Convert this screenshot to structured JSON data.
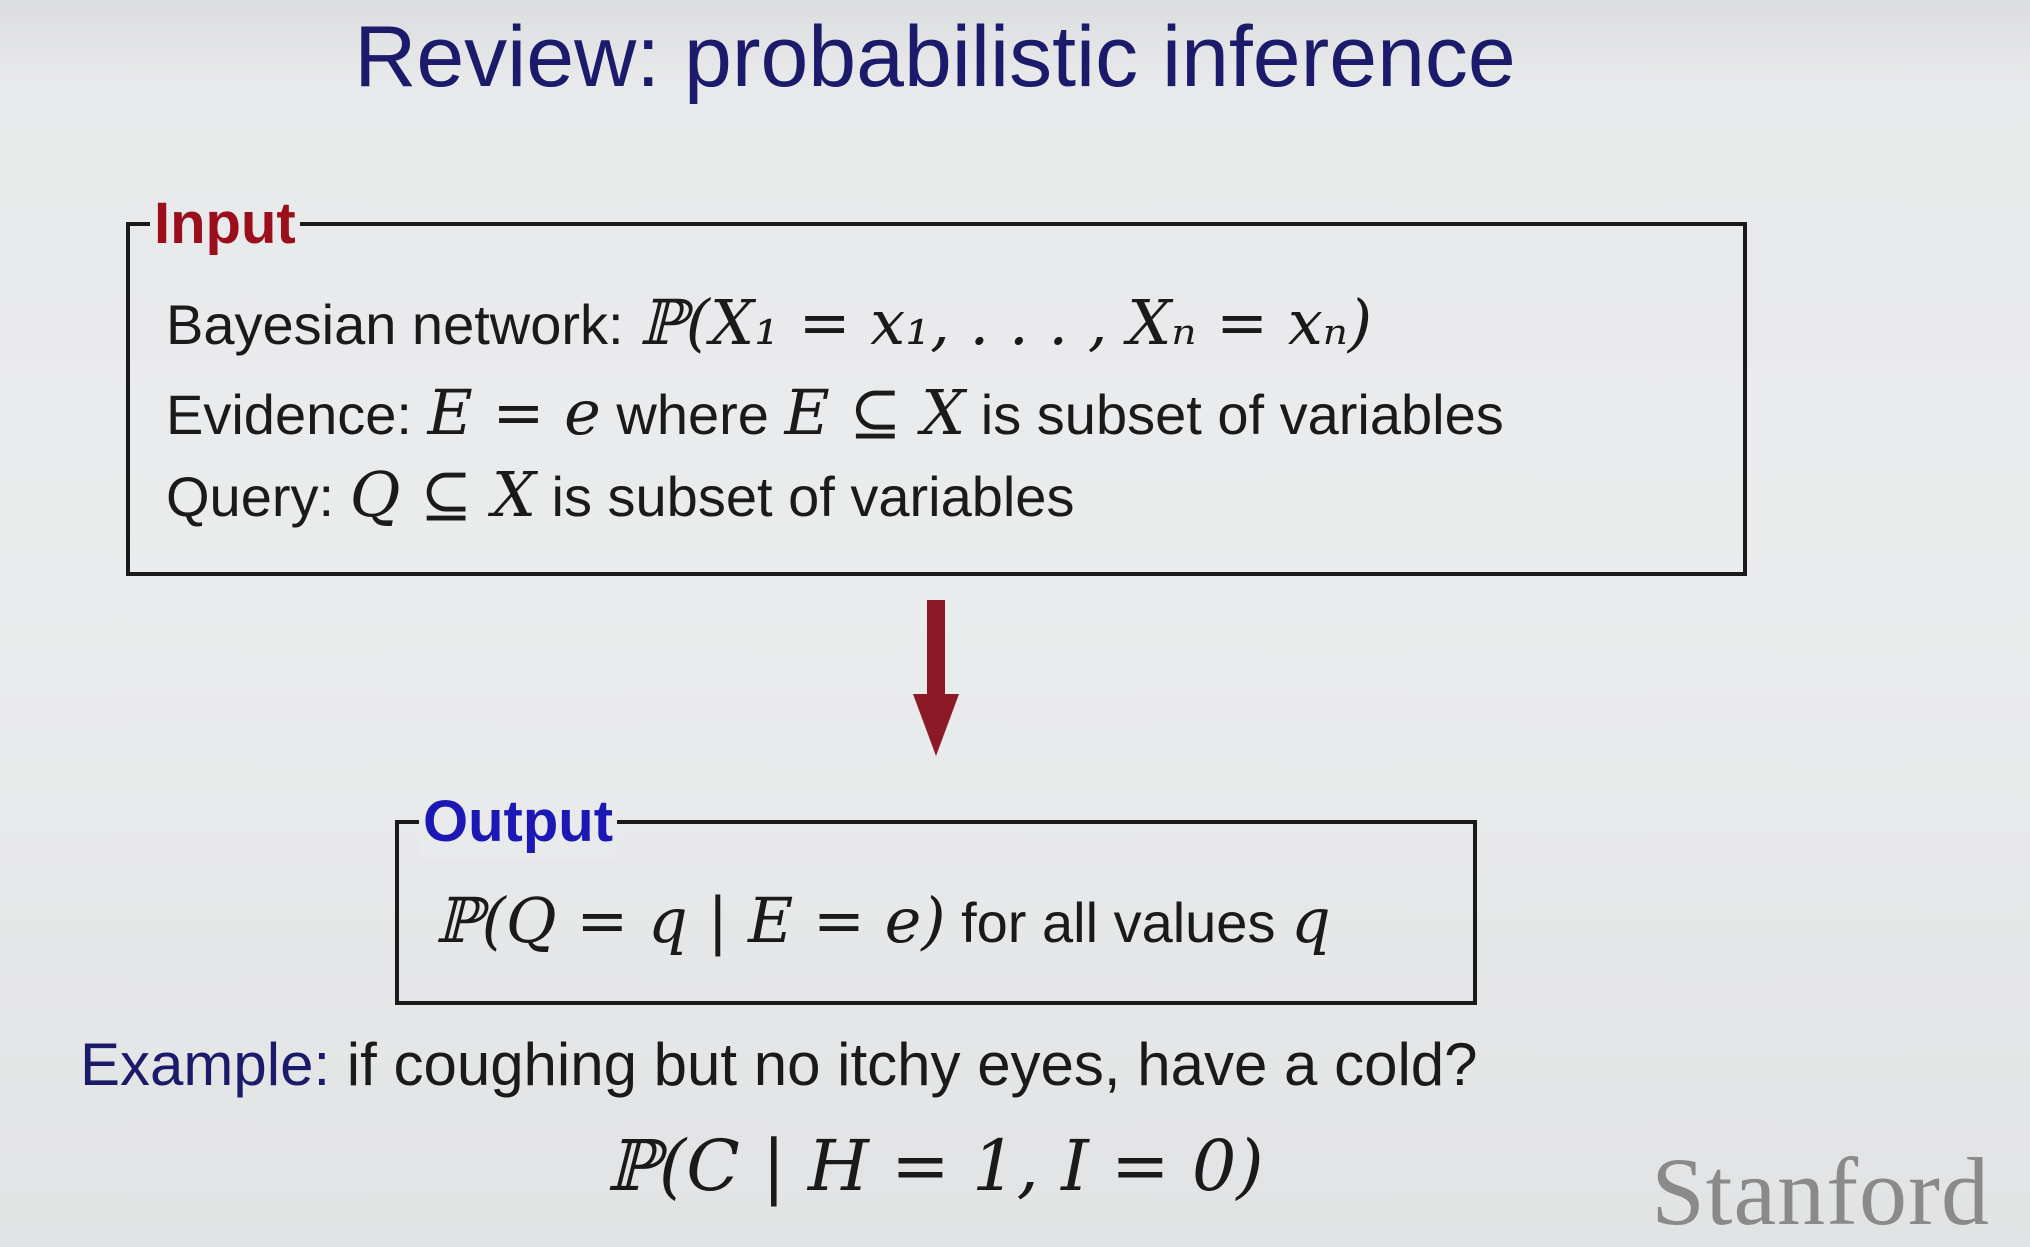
{
  "slide": {
    "title": "Review: probabilistic inference"
  },
  "input_box": {
    "label": "Input",
    "line1_text": "Bayesian network: ",
    "line1_math": "ℙ(X₁ = x₁, . . . , Xₙ = xₙ)",
    "line2_text": "Evidence: ",
    "line2_math_a": "E = e",
    "line2_text_b": " where ",
    "line2_math_b": "E ⊆ X",
    "line2_text_c": " is subset of variables",
    "line3_text": "Query: ",
    "line3_math": "Q ⊆ X",
    "line3_text_b": " is subset of variables"
  },
  "output_box": {
    "label": "Output",
    "math": "ℙ(Q = q | E = e)",
    "text": " for all values ",
    "math_b": "q"
  },
  "example": {
    "label": "Example:",
    "text": " if coughing but no itchy eyes, have a cold?",
    "math": "ℙ(C | H = 1, I = 0)"
  },
  "logo": {
    "text": "Stanford"
  },
  "colors": {
    "title": "#1c1a6b",
    "input_label": "#9b0e1c",
    "output_label": "#1c18b5",
    "arrow": "#8b1a26"
  }
}
